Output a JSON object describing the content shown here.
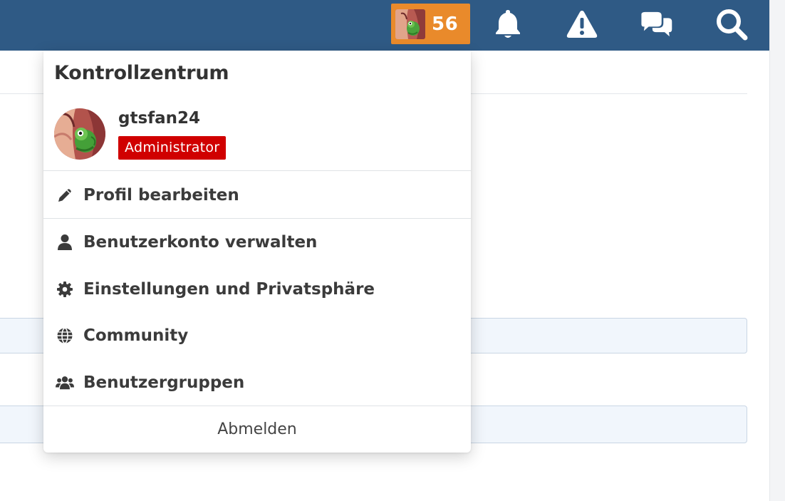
{
  "topbar": {
    "user_chip": {
      "count": "56",
      "avatar_icon": "user-avatar-chameleon"
    },
    "icons": [
      "bell-icon",
      "warning-icon",
      "conversations-icon",
      "search-icon"
    ],
    "colors": {
      "bar": "#2f5a85",
      "chip": "#e98a2b"
    }
  },
  "panel": {
    "title": "Kontrollzentrum",
    "user": {
      "name": "gtsfan24",
      "role": "Administrator",
      "role_color": "#d00000"
    },
    "menu": [
      {
        "label": "Profil bearbeiten",
        "icon": "pencil-icon"
      },
      {
        "label": "Benutzerkonto verwalten",
        "icon": "user-icon"
      },
      {
        "label": "Einstellungen und Privatsphäre",
        "icon": "gear-icon"
      },
      {
        "label": "Community",
        "icon": "globe-icon"
      },
      {
        "label": "Benutzergruppen",
        "icon": "users-icon"
      }
    ],
    "logout_label": "Abmelden"
  }
}
